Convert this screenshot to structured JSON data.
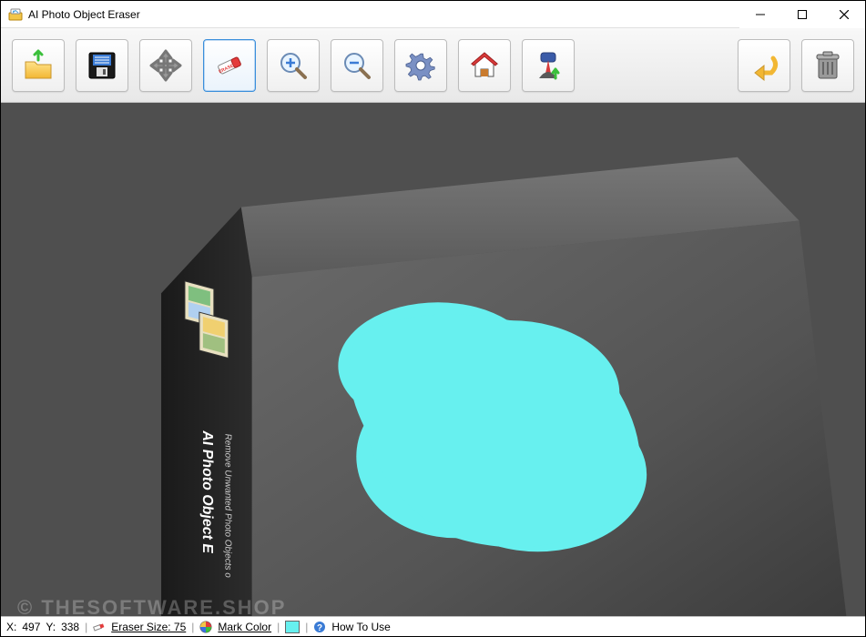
{
  "window": {
    "title": "AI Photo Object Eraser"
  },
  "toolbar": {
    "open": "Open",
    "save": "Save",
    "move": "Move",
    "eraser": "Eraser",
    "zoom_in": "Zoom In",
    "zoom_out": "Zoom Out",
    "settings": "Settings",
    "home": "Home",
    "register": "Register",
    "undo": "Undo",
    "delete": "Delete"
  },
  "status": {
    "coord_label_x": "X:",
    "coord_x": "497",
    "coord_label_y": "Y:",
    "coord_y": "338",
    "eraser_size_label": "Eraser Size: 75",
    "mark_color_label": "Mark Color",
    "mark_color_hex": "#67f0ef",
    "howto_label": "How To Use"
  },
  "watermark": "© THESOFTWARE.SHOP"
}
